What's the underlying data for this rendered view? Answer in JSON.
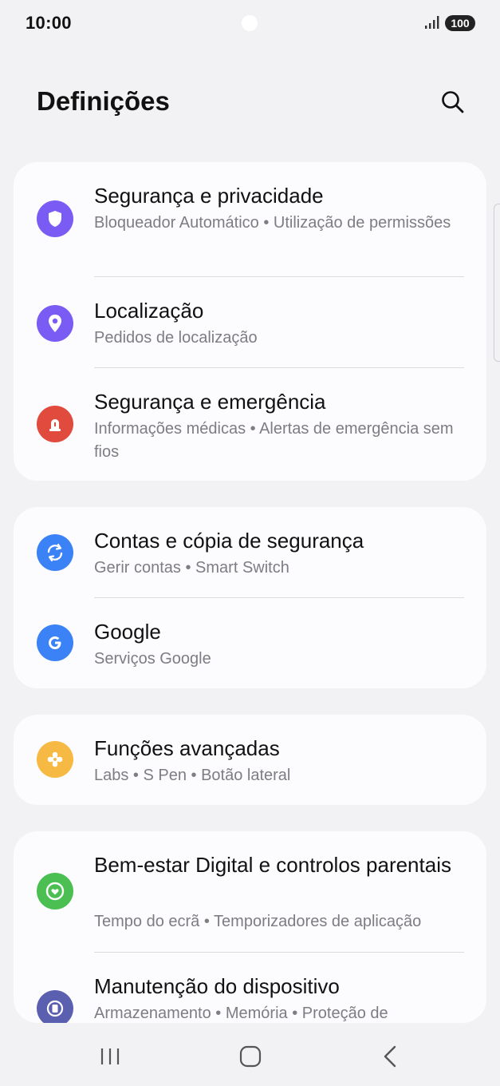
{
  "status_bar": {
    "time": "10:00",
    "battery": "100"
  },
  "header": {
    "title": "Definições"
  },
  "colors": {
    "security_privacy": "#7a5cf5",
    "location": "#7a5cf5",
    "safety_emergency": "#e04b3e",
    "accounts_backup": "#3b82f6",
    "google": "#3b82f6",
    "advanced_features": "#f6b944",
    "digital_wellbeing": "#4bbf52",
    "device_care": "#5a5fb0"
  },
  "settings": [
    {
      "title": "Segurança e privacidade",
      "subtitle": "Bloqueador Automático  •  Utilização de permissões",
      "icon": "shield-icon"
    },
    {
      "title": "Localização",
      "subtitle": "Pedidos de localização",
      "icon": "location-pin-icon"
    },
    {
      "title": "Segurança e emergência",
      "subtitle": "Informações médicas  •  Alertas de emergência sem fios",
      "icon": "emergency-siren-icon"
    },
    {
      "title": "Contas e cópia de segurança",
      "subtitle": "Gerir contas  •  Smart Switch",
      "icon": "sync-icon"
    },
    {
      "title": "Google",
      "subtitle": "Serviços Google",
      "icon": "google-icon"
    },
    {
      "title": "Funções avançadas",
      "subtitle": "Labs  •  S Pen  •  Botão lateral",
      "icon": "puzzle-gear-icon"
    },
    {
      "title": "Bem-estar Digital e controlos parentais",
      "subtitle": "Tempo do ecrã  •  Temporizadores de aplicação",
      "icon": "heart-circle-icon"
    },
    {
      "title": "Manutenção do dispositivo",
      "subtitle": "Armazenamento  •  Memória  •  Proteção de",
      "icon": "device-care-icon"
    }
  ],
  "nav_bar": {
    "recents_icon": "recents-icon",
    "home_icon": "home-icon",
    "back_icon": "back-icon"
  }
}
